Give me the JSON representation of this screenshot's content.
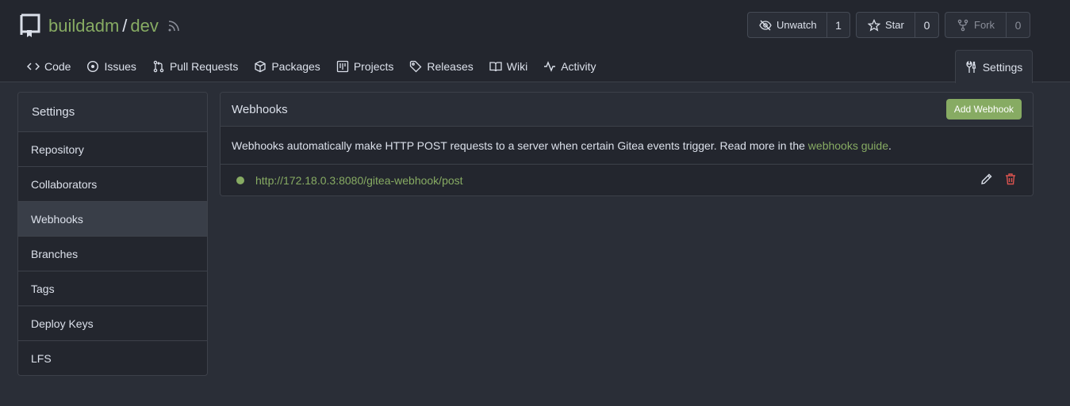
{
  "repo": {
    "owner": "buildadm",
    "separator": "/",
    "name": "dev"
  },
  "actions": {
    "watch": {
      "label": "Unwatch",
      "count": "1"
    },
    "star": {
      "label": "Star",
      "count": "0"
    },
    "fork": {
      "label": "Fork",
      "count": "0"
    }
  },
  "tabs": [
    {
      "label": "Code",
      "icon": "code-icon"
    },
    {
      "label": "Issues",
      "icon": "issue-icon"
    },
    {
      "label": "Pull Requests",
      "icon": "pull-request-icon"
    },
    {
      "label": "Packages",
      "icon": "package-icon"
    },
    {
      "label": "Projects",
      "icon": "project-icon"
    },
    {
      "label": "Releases",
      "icon": "tag-icon"
    },
    {
      "label": "Wiki",
      "icon": "book-icon"
    },
    {
      "label": "Activity",
      "icon": "pulse-icon"
    }
  ],
  "settings_tab": {
    "label": "Settings",
    "icon": "tools-icon"
  },
  "sidebar": {
    "title": "Settings",
    "items": [
      {
        "label": "Repository"
      },
      {
        "label": "Collaborators"
      },
      {
        "label": "Webhooks",
        "active": true
      },
      {
        "label": "Branches"
      },
      {
        "label": "Tags"
      },
      {
        "label": "Deploy Keys"
      },
      {
        "label": "LFS"
      }
    ]
  },
  "webhooks": {
    "title": "Webhooks",
    "add_button": "Add Webhook",
    "description": "Webhooks automatically make HTTP POST requests to a server when certain Gitea events trigger. Read more in the ",
    "guide_link": "webhooks guide",
    "description_end": ".",
    "hooks": [
      {
        "url": "http://172.18.0.3:8080/gitea-webhook/post",
        "status_color": "#87ab63"
      }
    ]
  },
  "colors": {
    "accent": "#87ab63",
    "danger": "#d9534f",
    "background": "#2a2e37",
    "header_bg": "#23262e"
  }
}
